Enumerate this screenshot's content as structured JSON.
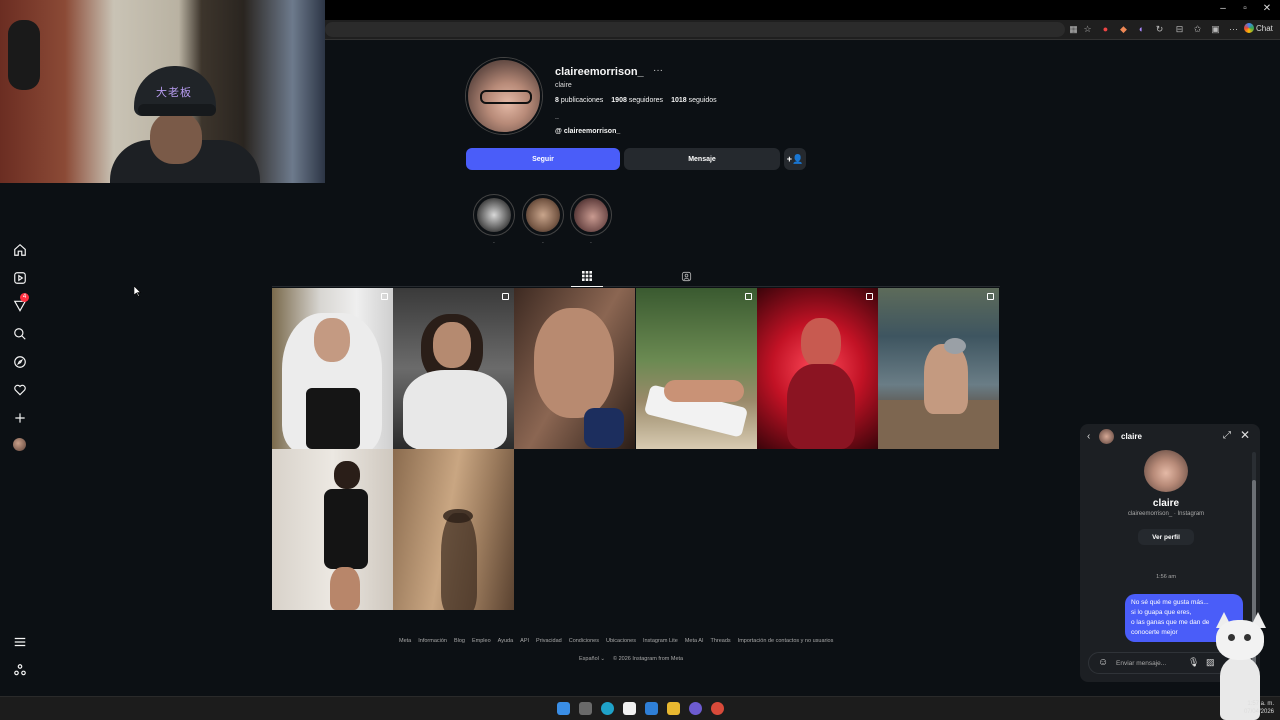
{
  "browser": {
    "chat_label": "Chat",
    "window_controls": [
      "–",
      "▫",
      "✕"
    ]
  },
  "webcam": {
    "cap_text": "大老板"
  },
  "nav": {
    "notification_count": "4",
    "items": [
      "home-icon",
      "reels-icon",
      "notifications-icon",
      "search-icon",
      "explore-icon",
      "heart-icon",
      "create-icon",
      "profile-avatar",
      "menu-icon",
      "also-from-meta-icon"
    ]
  },
  "profile": {
    "username": "claireemorrison_",
    "more": "···",
    "full_name": "claire",
    "posts_count": "8",
    "posts_label": "publicaciones",
    "followers_count": "1908",
    "followers_label": "seguidores",
    "following_count": "1018",
    "following_label": "seguidos",
    "bio": "..",
    "threads_handle": "claireemorrison_",
    "follow_button": "Seguir",
    "message_button": "Mensaje",
    "add_user_icon": "+👤"
  },
  "highlights": [
    {
      "label": "."
    },
    {
      "label": "."
    },
    {
      "label": "."
    }
  ],
  "tabs": {
    "posts": "posts-grid-icon",
    "tagged": "tagged-icon"
  },
  "footer": {
    "links": [
      "Meta",
      "Información",
      "Blog",
      "Empleo",
      "Ayuda",
      "API",
      "Privacidad",
      "Condiciones",
      "Ubicaciones",
      "Instagram Lite",
      "Meta AI",
      "Threads",
      "Importación de contactos y no usuarios"
    ],
    "language": "Español",
    "copyright": "© 2026 Instagram from Meta"
  },
  "chat": {
    "header_name": "claire",
    "name": "claire",
    "subtitle": "claireemorrison_ · Instagram",
    "view_profile": "Ver perfil",
    "time": "1:56 am",
    "message_lines": [
      "No sé qué me gusta más...",
      "si lo guapa que eres,",
      "o las ganas que me dan de",
      "conocerte mejor"
    ],
    "input_placeholder": "Enviar mensaje..."
  },
  "clock": {
    "time": "1:57 a. m.",
    "date": "07/04/2026"
  },
  "colors": {
    "accent": "#4a5df9",
    "background": "#0c1014",
    "badge": "#ff3040"
  }
}
